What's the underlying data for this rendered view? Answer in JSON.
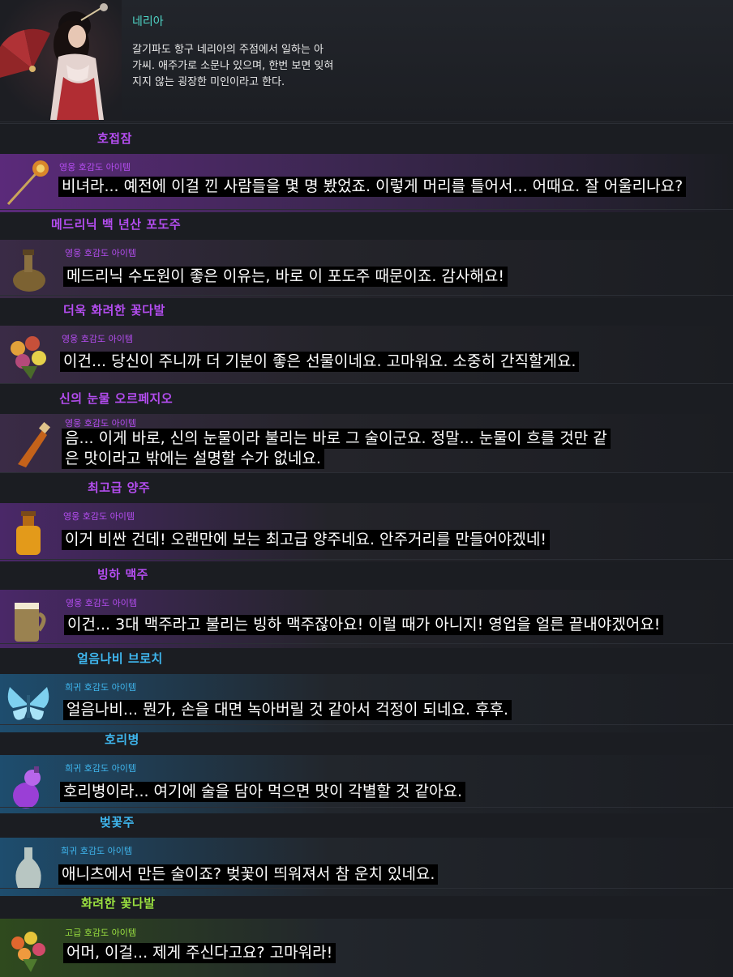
{
  "npc": {
    "name": "네리아",
    "description_lines": [
      "갈기파도 항구 네리아의 주점에서 일하는 아",
      "가씨. 애주가로 소문나 있으며, 한번 보면 잊혀",
      "지지 않는 굉장한 미인이라고 한다."
    ]
  },
  "colors": {
    "hero": "#b44df0",
    "rare": "#3fb7ef",
    "advanced": "#9ae040",
    "npc_name": "#4fd6c7"
  },
  "items": [
    {
      "name": "호접잠",
      "grade": "영웅 호감도 아이템",
      "tier": "hero",
      "icon": "hairpin-icon",
      "lines": [
        "비녀라... 예전에 이걸 낀 사람들을 몇 명 봤었죠. 이렇게 머리를 틀어서... 어때요. 잘 어울리나요?"
      ]
    },
    {
      "name": "메드리닉 백 년산 포도주",
      "grade": "영웅 호감도 아이템",
      "tier": "hero",
      "icon": "wine-gourd-icon",
      "lines": [
        "메드리닉 수도원이 좋은 이유는, 바로 이 포도주 때문이죠. 감사해요!"
      ]
    },
    {
      "name": "더욱 화려한 꽃다발",
      "grade": "영웅 호감도 아이템",
      "tier": "hero",
      "icon": "bouquet-icon",
      "lines": [
        "이건... 당신이 주니까 더 기분이 좋은 선물이네요. 고마워요. 소중히 간직할게요."
      ]
    },
    {
      "name": "신의 눈물 오르페지오",
      "grade": "영웅 호감도 아이템",
      "tier": "hero",
      "icon": "potion-bottle-icon",
      "lines": [
        "음... 이게 바로, 신의 눈물이라 불리는 바로 그 술이군요. 정말... 눈물이 흐를 것만 같",
        "은 맛이라고 밖에는 설명할 수가 없네요."
      ]
    },
    {
      "name": "최고급 양주",
      "grade": "영웅 호감도 아이템",
      "tier": "hero",
      "icon": "liquor-bottle-icon",
      "lines": [
        "이거 비싼 건데! 오랜만에 보는 최고급 양주네요. 안주거리를 만들어야겠네!"
      ]
    },
    {
      "name": "빙하 맥주",
      "grade": "영웅 호감도 아이템",
      "tier": "hero",
      "icon": "beer-mug-icon",
      "lines": [
        "이건... 3대 맥주라고 불리는 빙하 맥주잖아요! 이럴 때가 아니지! 영업을 얼른 끝내야겠어요!"
      ]
    },
    {
      "name": "얼음나비 브로치",
      "grade": "희귀 호감도 아이템",
      "tier": "rare",
      "icon": "butterfly-brooch-icon",
      "lines": [
        "얼음나비... 뭔가, 손을 대면 녹아버릴 것 같아서 걱정이 되네요. 후후."
      ]
    },
    {
      "name": "호리병",
      "grade": "희귀 호감도 아이템",
      "tier": "rare",
      "icon": "gourd-bottle-icon",
      "lines": [
        "호리병이라... 여기에 술을 담아 먹으면 맛이 각별할 것 같아요."
      ]
    },
    {
      "name": "벚꽃주",
      "grade": "희귀 호감도 아이템",
      "tier": "rare",
      "icon": "vase-bottle-icon",
      "lines": [
        "애니츠에서 만든 술이죠? 벚꽃이 띄워져서 참 운치 있네요."
      ]
    },
    {
      "name": "화려한 꽃다발",
      "grade": "고급 호감도 아이템",
      "tier": "advanced",
      "icon": "flower-bouquet-icon",
      "lines": [
        "어머, 이걸... 제게 주신다고요? 고마워라!"
      ]
    }
  ]
}
